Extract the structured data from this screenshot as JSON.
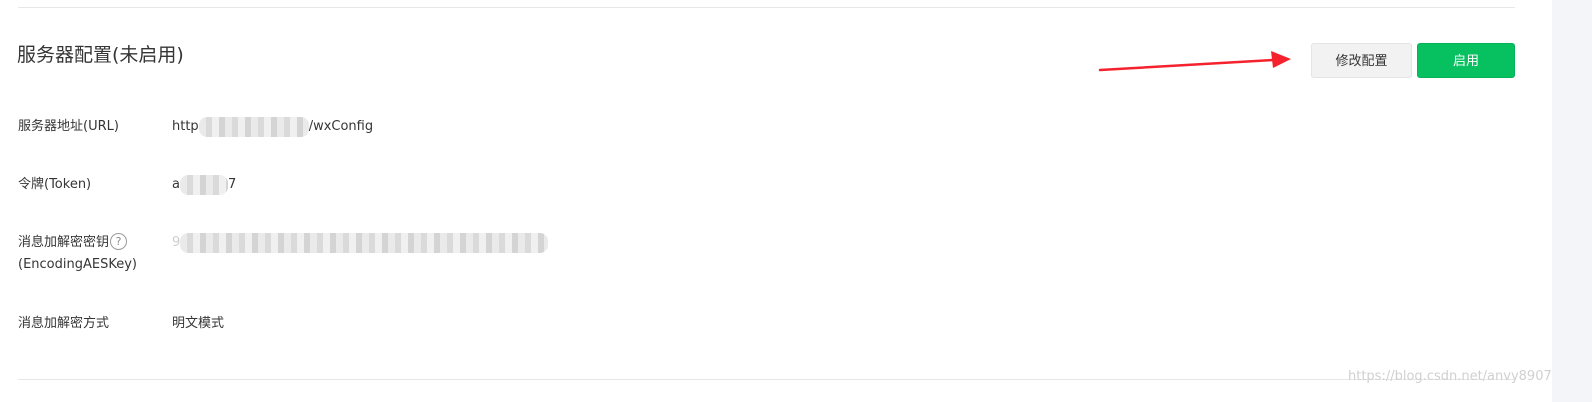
{
  "section": {
    "title": "服务器配置(未启用)"
  },
  "actions": {
    "edit_label": "修改配置",
    "enable_label": "启用"
  },
  "fields": {
    "url": {
      "label": "服务器地址(URL)",
      "value_prefix": "http",
      "value_suffix": "/wxConfig"
    },
    "token": {
      "label": "令牌(Token)",
      "value_prefix": "a",
      "value_suffix": "7"
    },
    "aes_key": {
      "label_line1": "消息加解密密钥",
      "help_glyph": "?",
      "label_line2": "(EncodingAESKey)",
      "value_prefix": "9"
    },
    "encrypt_mode": {
      "label": "消息加解密方式",
      "value": "明文模式"
    }
  },
  "watermark": {
    "text": "https://blog.csdn.net/anvy8907"
  },
  "colors": {
    "primary_green": "#07c160",
    "annotation_arrow": "#f5222d",
    "divider": "#e7e7eb"
  },
  "icons": {
    "help": "question-circle-icon",
    "annotation": "red-arrow-icon"
  }
}
